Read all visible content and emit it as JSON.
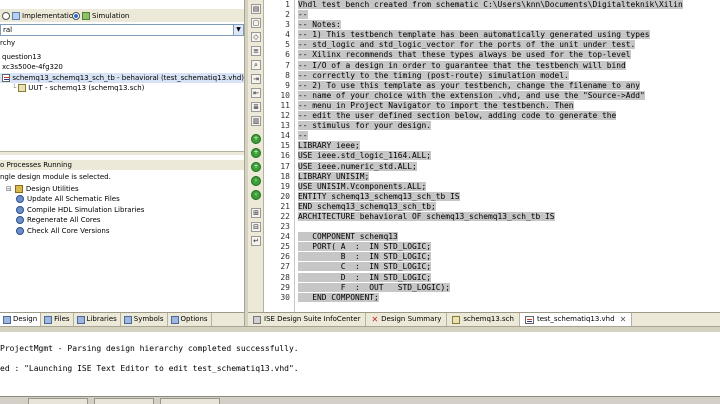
{
  "design_panel": {
    "view_implementation": "Implementation",
    "view_simulation": "Simulation",
    "view_selected": "Simulation",
    "sim_filter": "ral",
    "hierarchy": [
      "rchy",
      "question13",
      "xc3s500e-4fg320",
      "schemq13_schemq13_sch_tb - behavioral (test_schematiq13.vhd)",
      "UUT - schemq13 (schemq13.sch)"
    ],
    "processes_header": "o Processes Running",
    "processes_status": "ngle design module is selected.",
    "processes": [
      "Design Utilities",
      "Update All Schematic Files",
      "Compile HDL Simulation Libraries",
      "Regenerate All Cores",
      "Check All Core Versions"
    ]
  },
  "left_tabs": [
    "Design",
    "Files",
    "Libraries",
    "Symbols",
    "Options"
  ],
  "editor": {
    "line_numbers": [
      "1",
      "2",
      "3",
      "4",
      "5",
      "6",
      "7",
      "8",
      "9",
      "10",
      "11",
      "12",
      "13",
      "14",
      "15",
      "16",
      "17",
      "18",
      "19",
      "20",
      "21",
      "22",
      "23",
      "24",
      "25",
      "26",
      "27",
      "28",
      "29",
      "30"
    ],
    "lines": [
      "Vhdl test bench created from schematic C:\\Users\\knn\\Documents\\Digitalteknik\\Xilin",
      "--",
      "-- Notes:",
      "-- 1) This testbench template has been automatically generated using types",
      "-- std_logic and std_logic_vector for the ports of the unit under test.",
      "-- Xilinx recommends that these types always be used for the top-level",
      "-- I/O of a design in order to guarantee that the testbench will bind",
      "-- correctly to the timing (post-route) simulation model.",
      "-- 2) To use this template as your testbench, change the filename to any",
      "-- name of your choice with the extension .vhd, and use the \"Source->Add\"",
      "-- menu in Project Navigator to import the testbench. Then",
      "-- edit the user defined section below, adding code to generate the",
      "-- stimulus for your design.",
      "--",
      "LIBRARY ieee;",
      "USE ieee.std_logic_1164.ALL;",
      "USE ieee.numeric_std.ALL;",
      "LIBRARY UNISIM;",
      "USE UNISIM.Vcomponents.ALL;",
      "ENTITY schemq13_schemq13_sch_tb IS",
      "END schemq13_schemq13_sch_tb;",
      "ARCHITECTURE behavioral OF schemq13_schemq13_sch_tb IS",
      "",
      "   COMPONENT schemq13",
      "   PORT( A  :  IN STD_LOGIC;",
      "         B  :  IN STD_LOGIC;",
      "         C  :  IN STD_LOGIC;",
      "         D  :  IN STD_LOGIC;",
      "         F  :  OUT   STD_LOGIC);",
      "   END COMPONENT;"
    ]
  },
  "editor_tabs": [
    "ISE Design Suite InfoCenter",
    "Design Summary",
    "schemq13.sch",
    "test_schematiq13.vhd"
  ],
  "console": {
    "lines": [
      "ProjectMgmt - Parsing design hierarchy completed successfully.",
      "ed : \"Launching ISE Text Editor to edit test_schematiq13.vhd\"."
    ]
  }
}
